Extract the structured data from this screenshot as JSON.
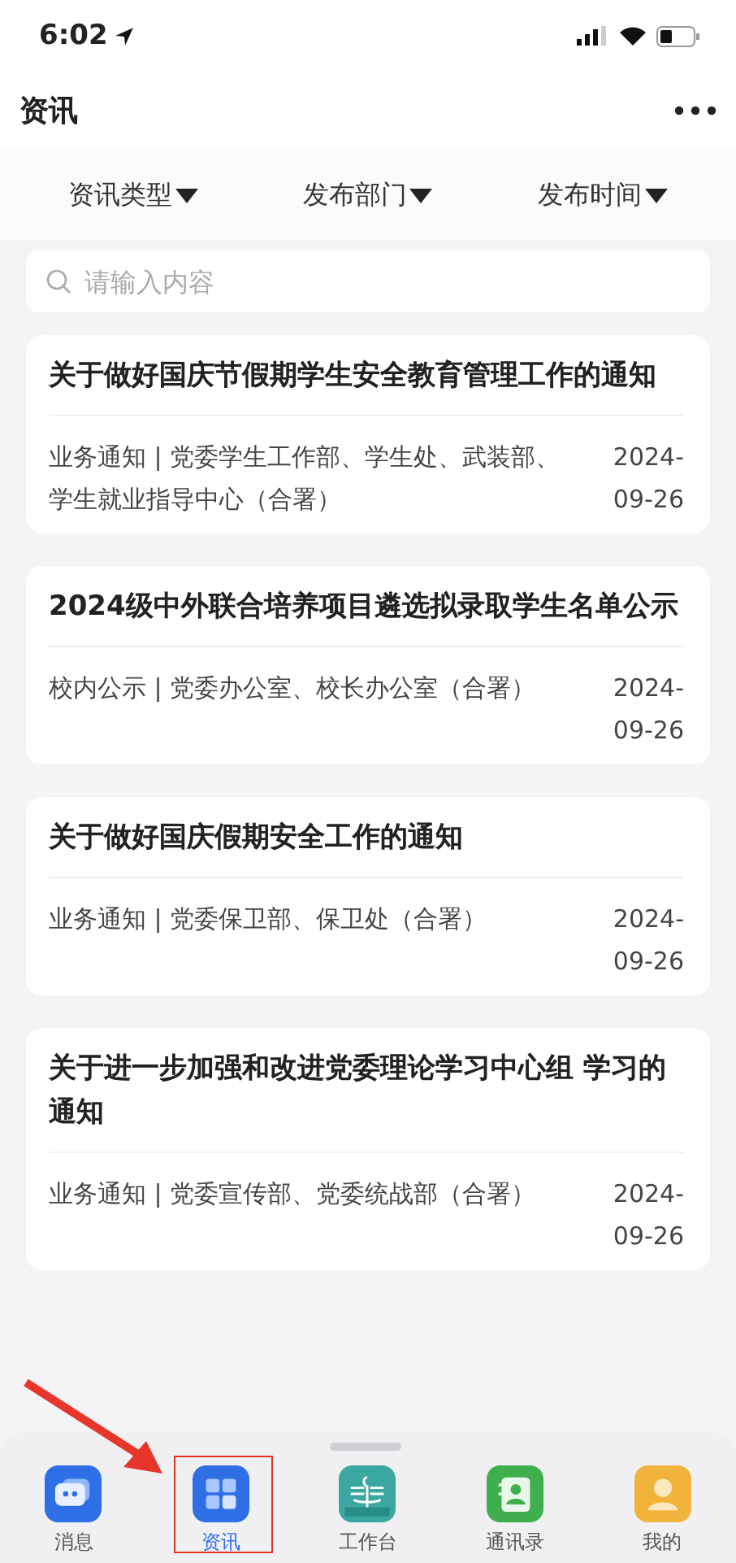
{
  "status_bar": {
    "time": "6:02"
  },
  "header": {
    "title": "资讯"
  },
  "filters": [
    {
      "label": "资讯类型"
    },
    {
      "label": "发布部门"
    },
    {
      "label": "发布时间"
    }
  ],
  "search": {
    "placeholder": "请输入内容"
  },
  "articles": [
    {
      "title": "关于做好国庆节假期学生安全教育管理工作的通知",
      "meta": "业务通知 | 党委学生工作部、学生处、武装部、学生就业指导中心（合署）",
      "date": "2024-09-26"
    },
    {
      "title": "2024级中外联合培养项目遴选拟录取学生名单公示",
      "meta": "校内公示 | 党委办公室、校长办公室（合署）",
      "date": "2024-09-26"
    },
    {
      "title": "关于做好国庆假期安全工作的通知",
      "meta": "业务通知 | 党委保卫部、保卫处（合署）",
      "date": "2024-09-26"
    },
    {
      "title": "关于进一步加强和改进党委理论学习中心组 学习的通知",
      "meta": "业务通知 | 党委宣传部、党委统战部（合署）",
      "date": "2024-09-26"
    }
  ],
  "tab_bar": [
    {
      "kind": "chat",
      "label": "消息",
      "selected": false
    },
    {
      "kind": "grid",
      "label": "资讯",
      "selected": true
    },
    {
      "kind": "workbench",
      "label": "工作台",
      "selected": false
    },
    {
      "kind": "contacts",
      "label": "通讯录",
      "selected": false
    },
    {
      "kind": "profile",
      "label": "我的",
      "selected": false
    }
  ]
}
